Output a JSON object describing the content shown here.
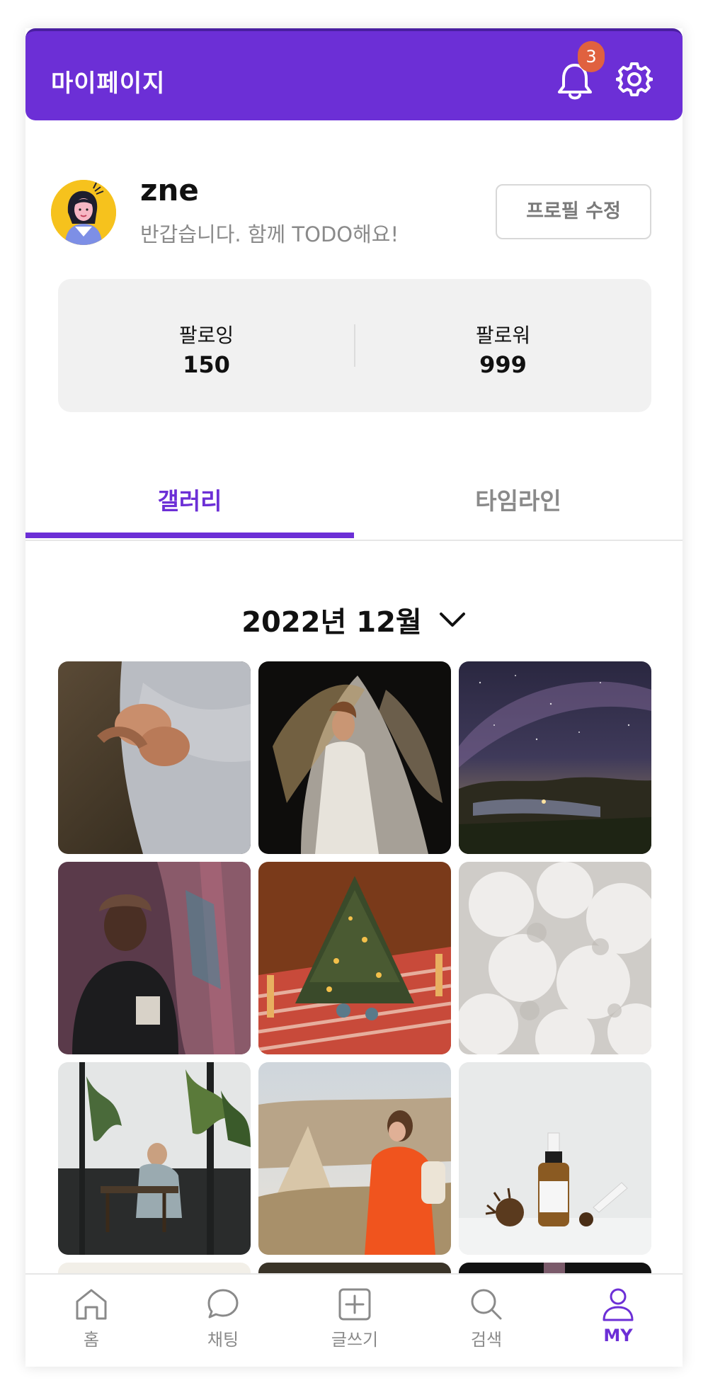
{
  "header": {
    "title": "마이페이지",
    "notification_count": "3"
  },
  "profile": {
    "username": "zne",
    "bio": "반갑습니다. 함께 TODO해요!",
    "edit_button": "프로필 수정"
  },
  "stats": {
    "following_label": "팔로잉",
    "following_count": "150",
    "followers_label": "팔로워",
    "followers_count": "999"
  },
  "tabs": [
    {
      "label": "갤러리",
      "active": true
    },
    {
      "label": "타임라인",
      "active": false
    }
  ],
  "month_selector": "2022년 12월",
  "gallery_items": [
    "hands-photo",
    "dancer-photo",
    "night-sky-photo",
    "portrait-photo",
    "christmas-tree-photo",
    "cotton-photo",
    "cafe-photo",
    "hiker-photo",
    "serum-bottle-photo"
  ],
  "bottom_nav": [
    {
      "label": "홈",
      "icon": "home-icon",
      "active": false
    },
    {
      "label": "채팅",
      "icon": "chat-icon",
      "active": false
    },
    {
      "label": "글쓰기",
      "icon": "write-icon",
      "active": false
    },
    {
      "label": "검색",
      "icon": "search-icon",
      "active": false
    },
    {
      "label": "MY",
      "icon": "user-icon",
      "active": true
    }
  ],
  "colors": {
    "primary": "#6c2fd6",
    "badge": "#e0613f",
    "muted": "#8a8a8a",
    "stats_bg": "#f1f1f1"
  }
}
